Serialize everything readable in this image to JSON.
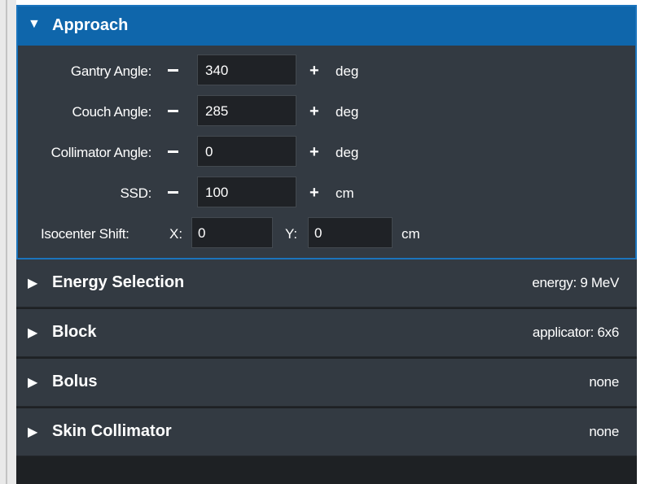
{
  "approach": {
    "title": "Approach",
    "expanded_icon": "triangle-down-icon",
    "gantry": {
      "label": "Gantry Angle:",
      "value": "340",
      "unit": "deg"
    },
    "couch": {
      "label": "Couch Angle:",
      "value": "285",
      "unit": "deg"
    },
    "collimator": {
      "label": "Collimator Angle:",
      "value": "0",
      "unit": "deg"
    },
    "ssd": {
      "label": "SSD:",
      "value": "100",
      "unit": "cm"
    },
    "isocenter": {
      "label": "Isocenter Shift:",
      "x_label": "X:",
      "x_value": "0",
      "y_label": "Y:",
      "y_value": "0",
      "unit": "cm"
    }
  },
  "sections": [
    {
      "title": "Energy Selection",
      "value": "energy: 9 MeV"
    },
    {
      "title": "Block",
      "value": "applicator: 6x6"
    },
    {
      "title": "Bolus",
      "value": "none"
    },
    {
      "title": "Skin Collimator",
      "value": "none"
    }
  ],
  "colors": {
    "accent": "#0f66ab",
    "panel": "#333a42",
    "input_bg": "#1f2226"
  }
}
